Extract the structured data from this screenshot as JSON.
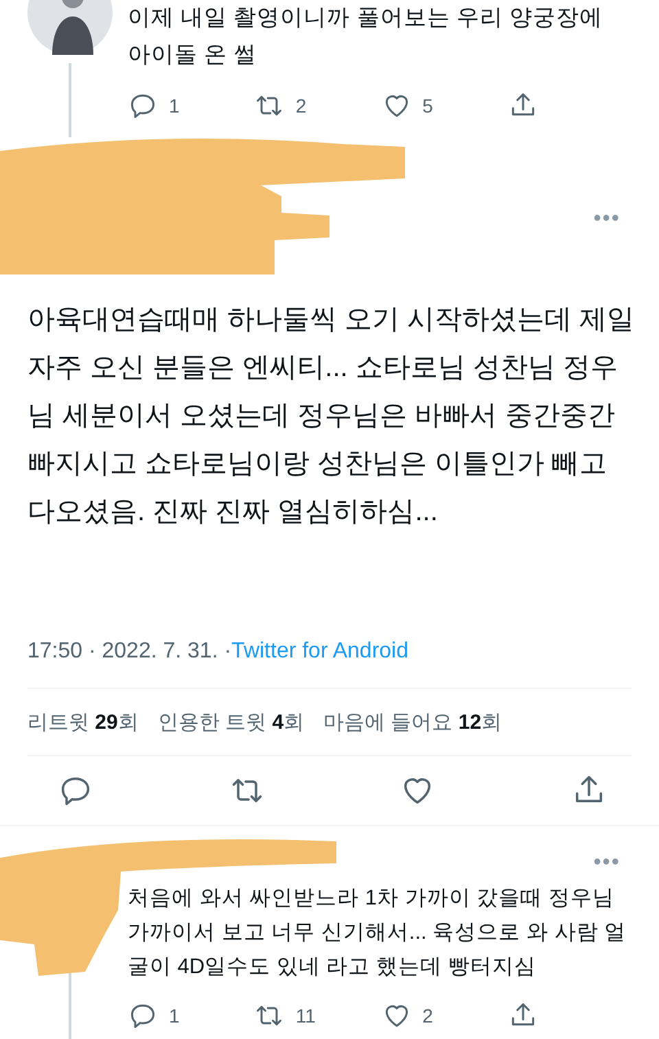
{
  "parent_tweet": {
    "text": "이제 내일 촬영이니까 풀어보는 우리 양궁장에 아이돌 온 썰",
    "actions": [
      {
        "kind": "reply",
        "count": "1"
      },
      {
        "kind": "retweet",
        "count": "2"
      },
      {
        "kind": "like",
        "count": "5"
      },
      {
        "kind": "share"
      }
    ]
  },
  "main_tweet": {
    "more": "•••",
    "text": "아육대연습때매 하나둘씩 오기 시작하셨는데 제일 자주 오신 분들은 엔씨티... 쇼타로님 성찬님 정우님 세분이서 오셨는데 정우님은 바빠서 중간중간 빠지시고 쇼타로님이랑 성찬님은 이틀인가 빼고 다오셨음. 진짜 진짜 열심히하심...",
    "time": "17:50 · 2022. 7. 31. · ",
    "source": "Twitter for Android",
    "counts": [
      "리트윗 **29**회",
      "인용한 트윗 **4**회",
      "마음에 들어요 **12**회"
    ],
    "actions": [
      {
        "kind": "reply"
      },
      {
        "kind": "retweet"
      },
      {
        "kind": "like"
      },
      {
        "kind": "share"
      }
    ]
  },
  "reply_tweet": {
    "more": "•••",
    "text": "처음에 와서 싸인받느라 1차 가까이 갔을때 정우님 가까이서 보고 너무 신기해서... 육성으로 와 사람 얼굴이 4D일수도 있네 라고 했는데 빵터지심",
    "actions": [
      {
        "kind": "reply",
        "count": "1"
      },
      {
        "kind": "retweet",
        "count": "11"
      },
      {
        "kind": "like",
        "count": "2"
      },
      {
        "kind": "share"
      }
    ]
  }
}
